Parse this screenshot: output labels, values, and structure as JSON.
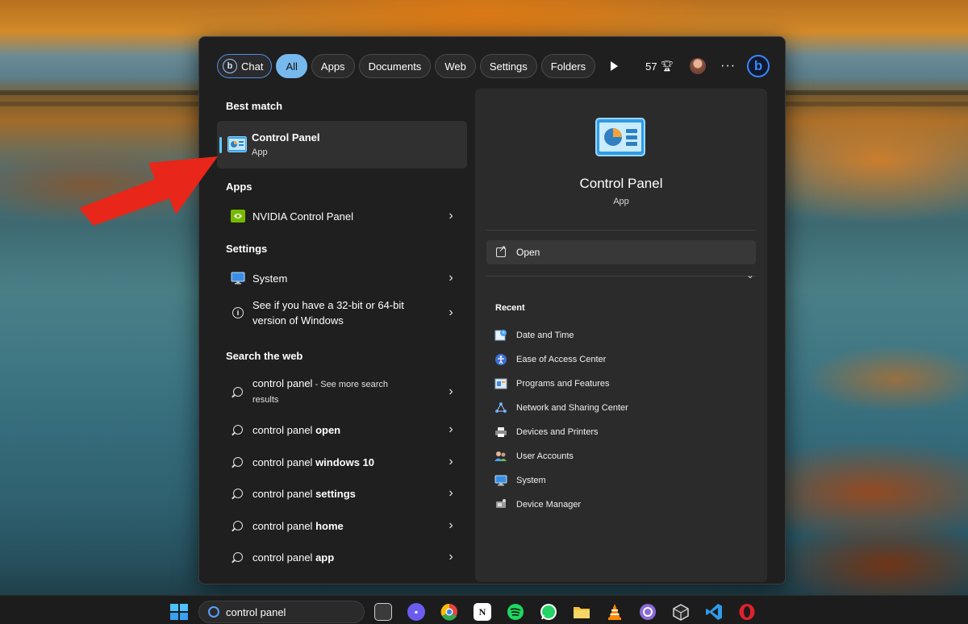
{
  "search": {
    "filters": [
      {
        "label": "Chat",
        "active": false
      },
      {
        "label": "All",
        "active": true
      },
      {
        "label": "Apps",
        "active": false
      },
      {
        "label": "Documents",
        "active": false
      },
      {
        "label": "Web",
        "active": false
      },
      {
        "label": "Settings",
        "active": false
      },
      {
        "label": "Folders",
        "active": false
      }
    ],
    "points": "57",
    "chat_icon_letter": "b",
    "bing_letter": "b"
  },
  "results": {
    "best_match_title": "Best match",
    "best_match": {
      "name": "Control Panel",
      "type": "App"
    },
    "apps_title": "Apps",
    "apps": [
      {
        "name": "NVIDIA Control Panel"
      }
    ],
    "settings_title": "Settings",
    "settings": [
      {
        "name": "System"
      },
      {
        "line1": "See if you have a 32-bit or 64-bit",
        "line2": "version of Windows"
      }
    ],
    "web_title": "Search the web",
    "web": [
      {
        "query": "control panel",
        "suffix": "",
        "extra": " - See more search",
        "extra2": "results"
      },
      {
        "query": "control panel ",
        "suffix": "open"
      },
      {
        "query": "control panel ",
        "suffix": "windows 10"
      },
      {
        "query": "control panel ",
        "suffix": "settings"
      },
      {
        "query": "control panel ",
        "suffix": "home"
      },
      {
        "query": "control panel ",
        "suffix": "app"
      }
    ]
  },
  "preview": {
    "name": "Control Panel",
    "type": "App",
    "open_label": "Open",
    "recent_title": "Recent",
    "recent": [
      {
        "label": "Date and Time",
        "icon": "clock-icon"
      },
      {
        "label": "Ease of Access Center",
        "icon": "accessibility-icon"
      },
      {
        "label": "Programs and Features",
        "icon": "programs-icon"
      },
      {
        "label": "Network and Sharing Center",
        "icon": "network-icon"
      },
      {
        "label": "Devices and Printers",
        "icon": "printer-icon"
      },
      {
        "label": "User Accounts",
        "icon": "users-icon"
      },
      {
        "label": "System",
        "icon": "monitor-icon"
      },
      {
        "label": "Device Manager",
        "icon": "device-manager-icon"
      }
    ]
  },
  "taskbar": {
    "search_query": "control panel",
    "apps": [
      {
        "icon": "task-view-icon",
        "color": "#d0d0d0"
      },
      {
        "icon": "teams-chat-icon",
        "color": "#7b6cf6"
      },
      {
        "icon": "chrome-icon",
        "color": "#e8453c"
      },
      {
        "icon": "notion-icon",
        "color": "#ffffff"
      },
      {
        "icon": "spotify-icon",
        "color": "#1ed760"
      },
      {
        "icon": "whatsapp-icon",
        "color": "#25d366"
      },
      {
        "icon": "file-explorer-icon",
        "color": "#f2c53d"
      },
      {
        "icon": "vlc-icon",
        "color": "#ff8800"
      },
      {
        "icon": "torrent-icon",
        "color": "#8a6bd8"
      },
      {
        "icon": "package-icon",
        "color": "#cfcfcf"
      },
      {
        "icon": "vscode-icon",
        "color": "#2f9be8"
      },
      {
        "icon": "opera-icon",
        "color": "#e0212b"
      }
    ]
  },
  "colors": {
    "accent": "#60cdff",
    "active_filter": "#76b9ed",
    "annotation_arrow": "#e8261a"
  }
}
